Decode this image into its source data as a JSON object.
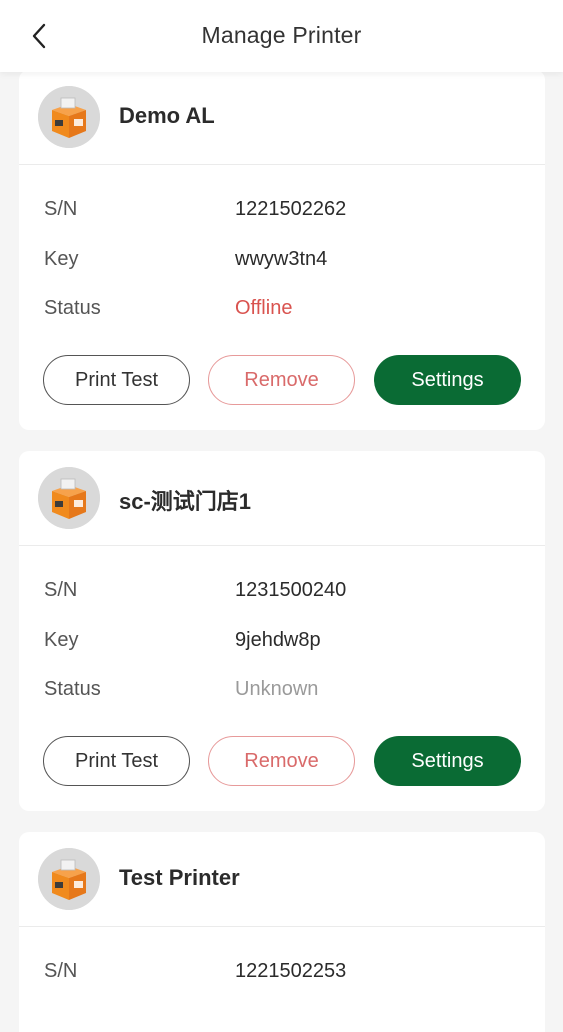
{
  "header": {
    "title": "Manage Printer"
  },
  "labels": {
    "sn": "S/N",
    "key": "Key",
    "status": "Status"
  },
  "buttons": {
    "print_test": "Print Test",
    "remove": "Remove",
    "settings": "Settings"
  },
  "printers": [
    {
      "name": "Demo AL",
      "sn": "1221502262",
      "key": "wwyw3tn4",
      "status": "Offline"
    },
    {
      "name": "sc-测试门店1",
      "sn": "1231500240",
      "key": "9jehdw8p",
      "status": "Unknown"
    },
    {
      "name": "Test Printer",
      "sn": "1221502253"
    }
  ],
  "colors": {
    "accent": "#0a6b34",
    "offline": "#d9534f",
    "remove": "#d96a6a",
    "unknown": "#9a9a9a"
  }
}
